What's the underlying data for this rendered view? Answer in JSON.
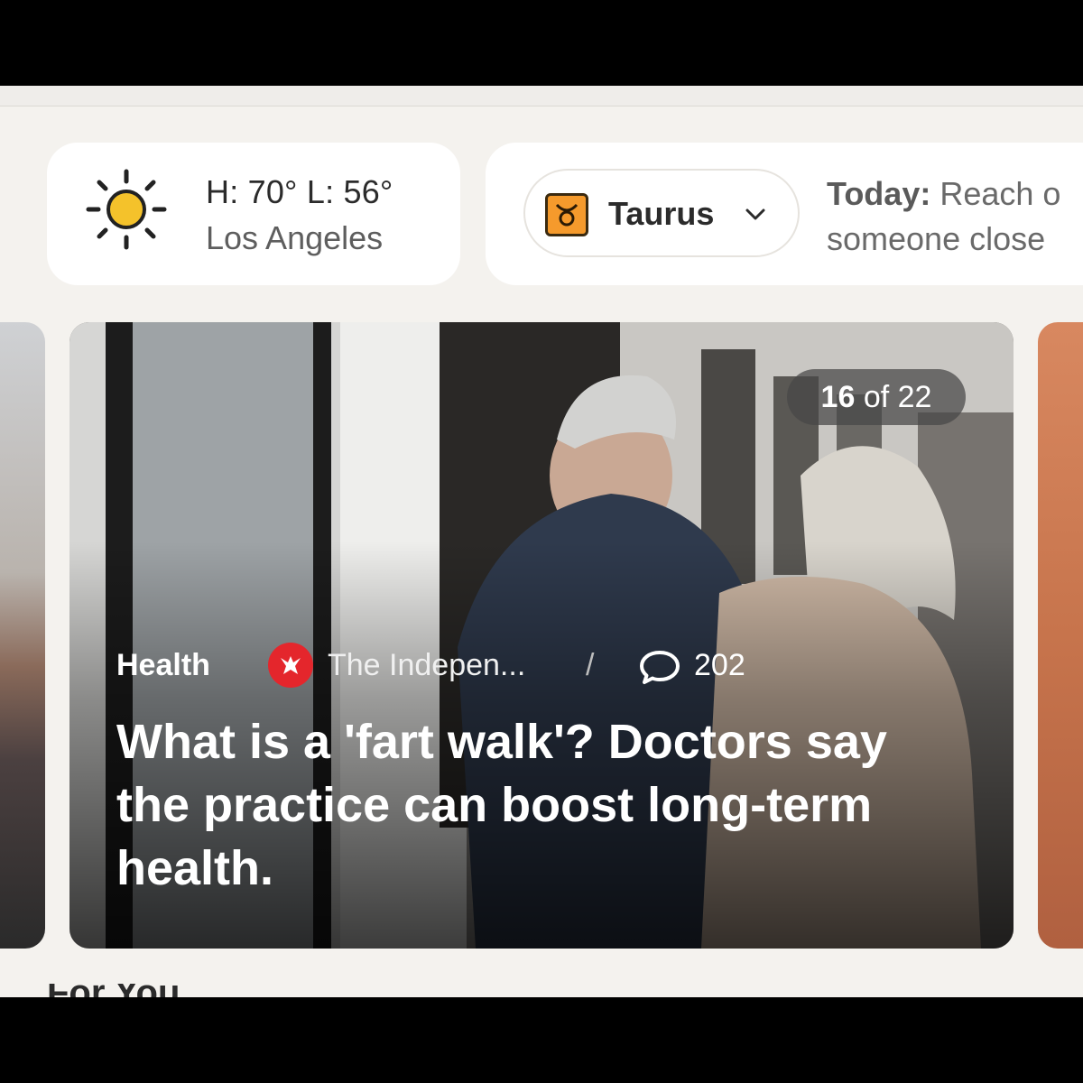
{
  "weather": {
    "high_low": "H: 70° L: 56°",
    "city": "Los Angeles",
    "icon": "sun-icon",
    "sun_color": "#f4c22b"
  },
  "horoscope": {
    "sign": "Taurus",
    "sign_icon": "taurus-icon",
    "sign_color": "#f59a2c",
    "today_label": "Today:",
    "text_line1": " Reach o",
    "text_line2": "someone close"
  },
  "carousel": {
    "counter_current": "16",
    "counter_rest": " of 22",
    "article": {
      "category": "Health",
      "source": "The Indepen...",
      "source_logo": "independent-eagle-logo",
      "separator": "/",
      "comments": "202",
      "headline": "What is a 'fart walk'? Doctors say the practice can boost long-term health."
    }
  },
  "next_section_peek": "For You"
}
